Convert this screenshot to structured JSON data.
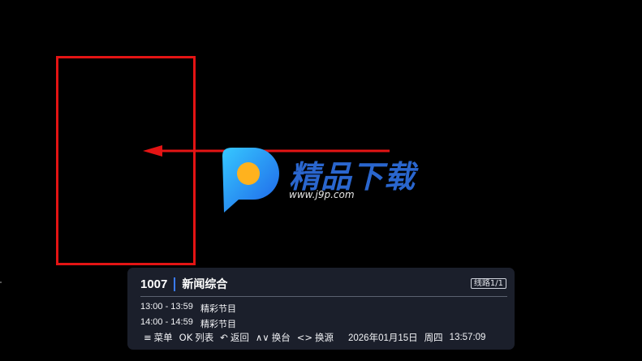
{
  "channel": {
    "number": "1007",
    "name": "新闻综合",
    "line_badge": "线路1/1"
  },
  "programs": [
    {
      "time": "13:00 - 13:59",
      "title": "精彩节目"
    },
    {
      "time": "14:00 - 14:59",
      "title": "精彩节目"
    }
  ],
  "hints": {
    "menu": {
      "key": "≡",
      "label": "菜单"
    },
    "list": {
      "key": "OK",
      "label": "列表"
    },
    "back": {
      "key": "↶",
      "label": "返回"
    },
    "switch_channel": {
      "key": "∧∨",
      "label": "换台"
    },
    "switch_source": {
      "key": "<>",
      "label": "换源"
    }
  },
  "datetime": {
    "date": "2026年01月15日",
    "weekday": "周四",
    "time": "13:57:09"
  },
  "watermark": {
    "brand": "精品下载",
    "url": "www.j9p.com"
  },
  "colors": {
    "annotation": "#e41414",
    "panel_bg": "#1b1f2b",
    "accent": "#3a7bff"
  }
}
